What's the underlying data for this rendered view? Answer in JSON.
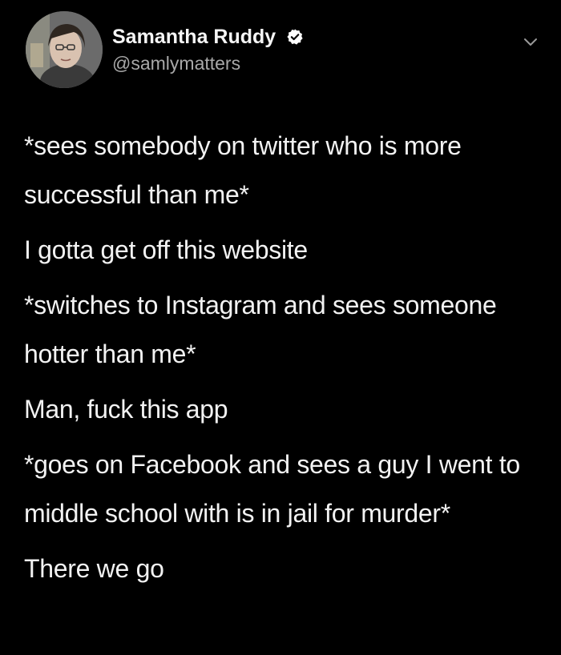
{
  "author": {
    "display_name": "Samantha Ruddy",
    "handle": "@samlymatters",
    "verified": true,
    "verified_icon": "verified-badge-icon",
    "avatar_icon": "profile-photo"
  },
  "menu": {
    "icon": "chevron-down-icon"
  },
  "tweet": {
    "paragraphs": [
      "*sees somebody on twitter who is more successful than me*",
      "I gotta get off this website",
      "*switches to Instagram and sees someone hotter than me*",
      "Man, fuck this app",
      "*goes on Facebook and sees a guy I went to middle school with is in jail for murder*",
      "There we go"
    ]
  },
  "colors": {
    "background": "#000000",
    "text": "#f2f2f2",
    "handle": "#a8a8a8",
    "verified": "#ffffff"
  }
}
